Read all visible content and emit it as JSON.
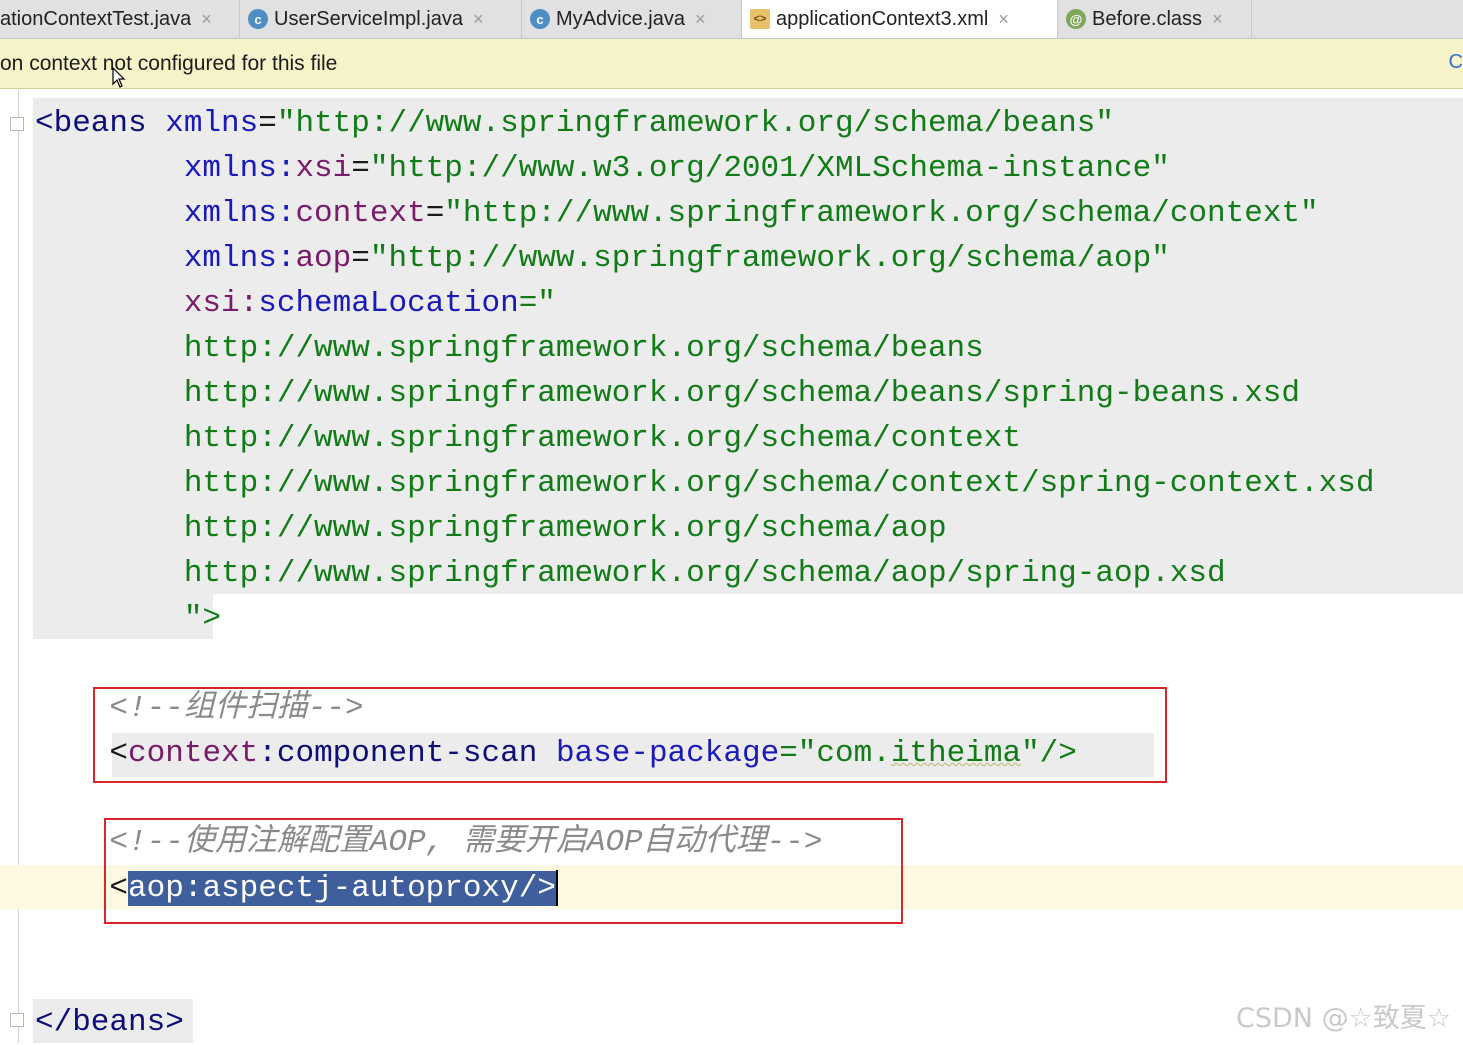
{
  "tabs": [
    {
      "icon": "class-file-icon",
      "label": "ationContextTest.java",
      "active": false
    },
    {
      "icon": "class-file-icon",
      "label": "UserServiceImpl.java",
      "active": false
    },
    {
      "icon": "class-file-icon",
      "label": "MyAdvice.java",
      "active": false
    },
    {
      "icon": "xml-file-icon",
      "label": "applicationContext3.xml",
      "active": true
    },
    {
      "icon": "annotation-class-icon",
      "label": "Before.class",
      "active": false
    }
  ],
  "tab_icon_glyphs": {
    "class": "c",
    "anno": "@",
    "xml": "<>"
  },
  "tab_close_glyph": "×",
  "notice": {
    "text": "on context not configured for this file",
    "link": "C"
  },
  "code": {
    "beans_open": "<beans",
    "xmlns_attr": "xmlns",
    "eq": "=",
    "xmlns_val": "\"http://www.springframework.org/schema/beans\"",
    "xsi_prefix": "xmlns:",
    "xsi_name": "xsi",
    "xsi_val": "\"http://www.w3.org/2001/XMLSchema-instance\"",
    "context_name": "context",
    "context_val": "\"http://www.springframework.org/schema/context\"",
    "aop_name": "aop",
    "aop_val": "\"http://www.springframework.org/schema/aop\"",
    "schema_prefix": "xsi:",
    "schema_name": "schemaLocation",
    "schema_open": "=\"",
    "schema_lines": [
      "http://www.springframework.org/schema/beans",
      "http://www.springframework.org/schema/beans/spring-beans.xsd",
      "http://www.springframework.org/schema/context",
      "http://www.springframework.org/schema/context/spring-context.xsd",
      "http://www.springframework.org/schema/aop",
      "http://www.springframework.org/schema/aop/spring-aop.xsd"
    ],
    "schema_close": "\">",
    "comment_scan": "<!--组件扫描-->",
    "scan_lt": "<",
    "scan_ns": "context",
    "scan_colon": ":",
    "scan_tag": "component-scan",
    "scan_attr": "base-package",
    "scan_eq": "=\"",
    "scan_pkg_a": "com.",
    "scan_pkg_b": "itheima",
    "scan_end": "\"/>",
    "comment_aop": "<!--使用注解配置AOP, 需要开启AOP自动代理-->",
    "aop_lt": "<",
    "aop_selected": "aop:aspectj-autoproxy/>",
    "beans_close": "</beans>"
  },
  "watermark": "CSDN @☆致夏☆"
}
